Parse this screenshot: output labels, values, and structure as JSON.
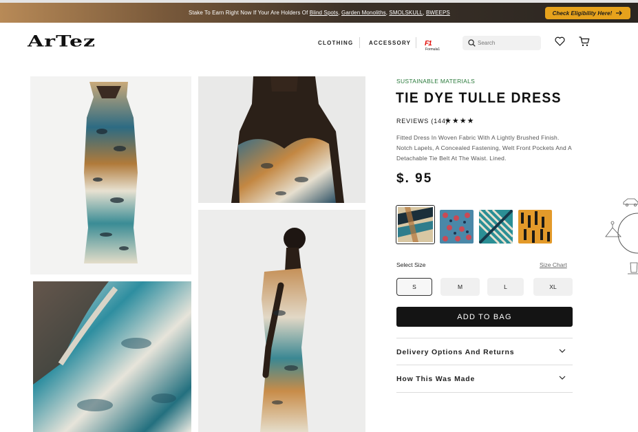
{
  "banner": {
    "prefix": "Stake To Earn Right Now If Your Are Holders Of ",
    "links": [
      "Blind Spots",
      "Garden Monoliths",
      "SMOLSKULL",
      "BWEEPS"
    ],
    "cta": "Check Eligibility Here!"
  },
  "header": {
    "logo": "ArTez",
    "nav": [
      "CLOTHING",
      "ACCESSORY"
    ],
    "partner_label": "Formula1",
    "search_placeholder": "Search"
  },
  "product": {
    "category": "SUSTAINABLE MATERIALS",
    "name": "TIE DYE TULLE DRESS",
    "reviews_label": "REVIEWS (144)",
    "stars": "★★★★",
    "rating": 4,
    "description": "Fitted Dress In Woven Fabric With A Lightly Brushed Finish. Notch Lapels, A Concealed Fastening, Welt Front Pockets And A Detachable Tie Belt At The Waist. Lined.",
    "price": "$. 95",
    "size_label": "Select Size",
    "size_chart": "Size Chart",
    "sizes": [
      "S",
      "M",
      "L",
      "XL"
    ],
    "selected_size": "S",
    "add_to_bag": "ADD TO BAG",
    "accordion": [
      "Delivery Options And Returns",
      "How This Was Made"
    ]
  },
  "colors": {
    "brand_orange": "#e6a21c",
    "sustainable_green": "#2a7a3b",
    "button_dark": "#141414"
  }
}
